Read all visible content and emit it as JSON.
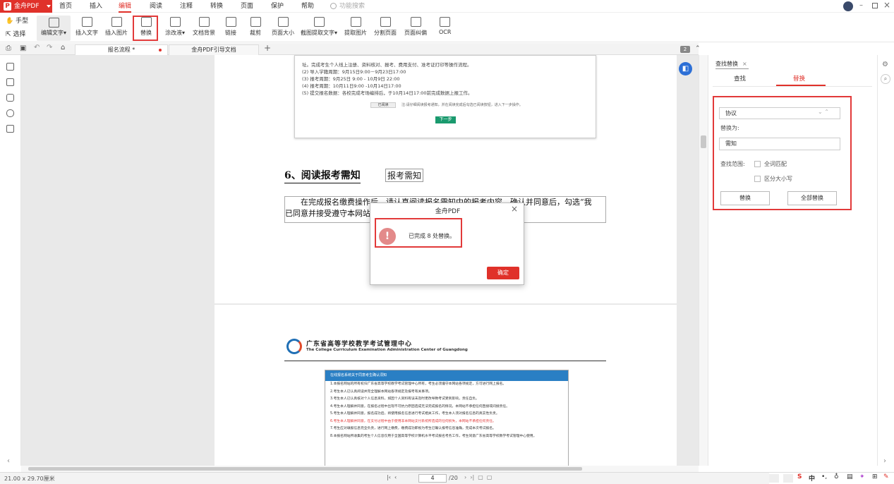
{
  "app": {
    "name": "金舟PDF",
    "logo_letter": "P"
  },
  "menu": {
    "items": [
      "首页",
      "插入",
      "编辑",
      "阅读",
      "注释",
      "转换",
      "页面",
      "保护",
      "帮助"
    ],
    "active": "编辑",
    "search_placeholder": "功能搜索"
  },
  "toolbar": {
    "left_tools": [
      "手型",
      "选择"
    ],
    "edit_text": "编辑文字",
    "tools": [
      "插入文字",
      "插入图片",
      "替换",
      "涂改液",
      "文档背景",
      "链接",
      "裁剪",
      "页面大小",
      "截图提取文字",
      "提取图片",
      "分割页面",
      "页面纠偏",
      "OCR"
    ]
  },
  "tabs": [
    {
      "label": "报名流程 *",
      "modified": true
    },
    {
      "label": "金舟PDF引导文档",
      "modified": false
    }
  ],
  "tab_add": "+",
  "page_badge": "2",
  "document": {
    "shot1_lines": [
      "址。完成考生个人线上注册、资料核对、报考、费用支付、准考证打印等操作流程。",
      "(2) 导入学籍周期：9月15日9:00－9月23日17:00",
      "(3) 报考周期：9月25日 9:00 - 10月9日 22:00",
      "(4) 报考周期：10月11日9:00 -10月14日17:00",
      "(5) 提交报名数据：各校完成考场编排后，于10月14日17:00前完成数据上报工作。"
    ],
    "shot1_checkbox": "已阅读",
    "shot1_note": "注:请仔细阅读报考通知，并在阅读完成后勾选已阅读按钮，进入下一步操作。",
    "shot1_button": "下一步",
    "heading": "6、阅读报考需知",
    "heading_replaced": "报考需知",
    "paragraph_line1": "在完成报名缴费操作后，请认真阅读报名需知中的报考内容，确认并同意后，勾选“我",
    "paragraph_line2": "已同意并接受遵守本网站",
    "org_title": "广东省高等学校教学考试管理中心",
    "org_subtitle": "The College Curriculum Examination Administration Center of Guangdong",
    "shot2_header": "在线报名系统关于同意考生确认须知",
    "shot2_rules": [
      "1.本报名网站的所有权归广东省高等学校教学考试管理中心所有，考生必须遵守本网站各项规定，方可进行网上报名。",
      "2.考生本人已认真阅读并完全理解本网站各项规定及报考有关事项。",
      "3.考生本人已认真核对个人信息资料，如因个人资料有误未及时更改导致考试受到影响，责任自负。",
      "4.考生本人理解并同意，在报名过程中出现不可抗力原因造成无法完成报名的情况，本网站不承担任何直接或间接责任。",
      "5.考生本人理解并同意，报名成功后，将使用报名信息进行考试相关工作，考生本人须对报名信息的真实性负责。",
      "6.考生本人理解并同意，在支付过程中由于使用非本网站支付系统所造成的任何损失，本网站不承担任何责任。",
      "7.考生应对填报信息完全负责，进行网上缴费，缴费成功即视为考生已确认报考信息准确，完成本次考试报名。",
      "8.本报名网站所收集的考生个人信息仅用于全国高等学校计算机水平考试报名考务工作，考生同意广东省高等学校教学考试管理中心使用。"
    ],
    "shot2_red_index": 5
  },
  "dialog": {
    "title": "金舟PDF",
    "message": "已完成 8 处替换。",
    "ok": "确定",
    "alert_glyph": "!"
  },
  "panel": {
    "tab": "查找替换",
    "find_tab": "查找",
    "replace_tab": "替换",
    "find_value": "协议",
    "replace_label": "替换为:",
    "replace_value": "需知",
    "scope_label": "查找范围:",
    "whole_word": "全词匹配",
    "match_case": "区分大小写",
    "replace_btn": "替换",
    "replace_all_btn": "全部替换"
  },
  "status": {
    "page_size": "21.00 x 29.70厘米",
    "current_page": "4",
    "total_pages": "/20"
  },
  "ime": {
    "lang": "中"
  },
  "colors": {
    "brand": "#e0312a",
    "highlight": "#e23a3a",
    "accent_blue": "#2c6fd6"
  }
}
